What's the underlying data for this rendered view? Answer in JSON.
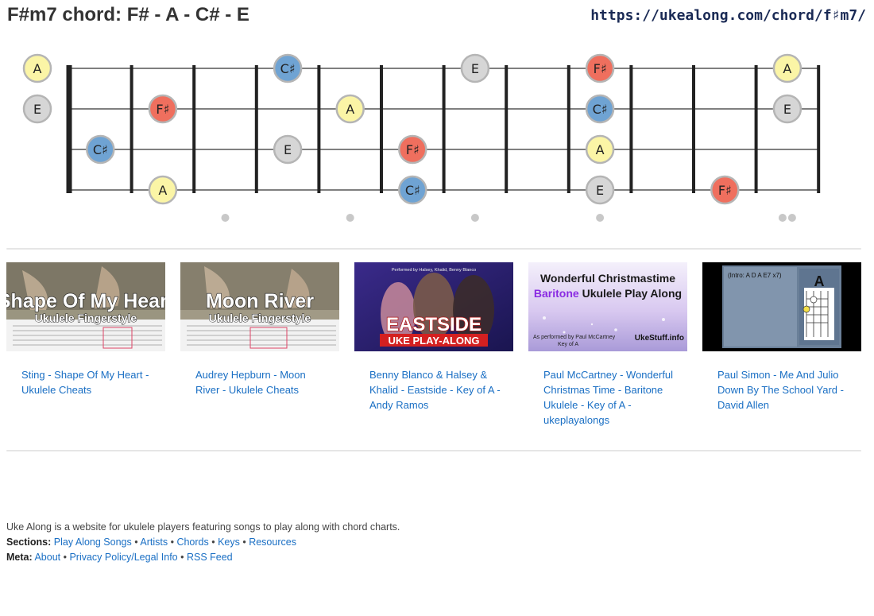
{
  "page": {
    "title": "F#m7 chord: F# - A - C# - E",
    "url": "https://ukealong.com/chord/f♯m7/"
  },
  "fretboard": {
    "strings": 4,
    "frets": 12,
    "inlay_frets": [
      3,
      5,
      7,
      9,
      12
    ],
    "colors": {
      "F♯": "#ef6f5e",
      "A": "#fbf5a6",
      "C♯": "#6fa3d3",
      "E": "#d6d6d6"
    },
    "notes": [
      {
        "string": 1,
        "fret": 0,
        "note": "A"
      },
      {
        "string": 1,
        "fret": 4,
        "note": "C♯"
      },
      {
        "string": 1,
        "fret": 7,
        "note": "E"
      },
      {
        "string": 1,
        "fret": 9,
        "note": "F♯"
      },
      {
        "string": 1,
        "fret": 12,
        "note": "A"
      },
      {
        "string": 2,
        "fret": 0,
        "note": "E"
      },
      {
        "string": 2,
        "fret": 2,
        "note": "F♯"
      },
      {
        "string": 2,
        "fret": 5,
        "note": "A"
      },
      {
        "string": 2,
        "fret": 9,
        "note": "C♯"
      },
      {
        "string": 2,
        "fret": 12,
        "note": "E"
      },
      {
        "string": 3,
        "fret": 1,
        "note": "C♯"
      },
      {
        "string": 3,
        "fret": 4,
        "note": "E"
      },
      {
        "string": 3,
        "fret": 6,
        "note": "F♯"
      },
      {
        "string": 3,
        "fret": 9,
        "note": "A"
      },
      {
        "string": 4,
        "fret": 2,
        "note": "A"
      },
      {
        "string": 4,
        "fret": 6,
        "note": "C♯"
      },
      {
        "string": 4,
        "fret": 9,
        "note": "E"
      },
      {
        "string": 4,
        "fret": 11,
        "note": "F♯"
      }
    ]
  },
  "videos": [
    {
      "thumb_line1": "Shape Of My Heart",
      "thumb_line2": "Ukulele Fingerstyle",
      "link": "Sting - Shape Of My Heart - Ukulele Cheats"
    },
    {
      "thumb_line1": "Moon River",
      "thumb_line2": "Ukulele Fingerstyle",
      "link": "Audrey Hepburn - Moon River - Ukulele Cheats"
    },
    {
      "thumb_top": "Performed by Halsey, Khalid, Benny Blanco",
      "thumb_line1": "EASTSIDE",
      "thumb_line2": "UKE PLAY-ALONG",
      "link": "Benny Blanco & Halsey & Khalid - Eastside - Key of A - Andy Ramos"
    },
    {
      "thumb_line1": "Wonderful Christmastime",
      "thumb_line2a": "Baritone",
      "thumb_line2b": " Ukulele Play Along",
      "thumb_small": "As performed by Paul McCartney",
      "thumb_key": "Key of A",
      "thumb_brand": "UkeStuff.info",
      "link": "Paul McCartney - Wonderful Christmas Time - Baritone Ukulele - Key of A - ukeplayalongs"
    },
    {
      "thumb_intro": "(Intro: A D A E7 x7)",
      "thumb_chord": "A",
      "link": "Paul Simon - Me And Julio Down By The School Yard - David Allen"
    }
  ],
  "footer": {
    "about": "Uke Along is a website for ukulele players featuring songs to play along with chord charts.",
    "sections_label": "Sections:",
    "sections": [
      "Play Along Songs",
      "Artists",
      "Chords",
      "Keys",
      "Resources"
    ],
    "meta_label": "Meta:",
    "meta": [
      "About",
      "Privacy Policy/Legal Info",
      "RSS Feed"
    ]
  }
}
